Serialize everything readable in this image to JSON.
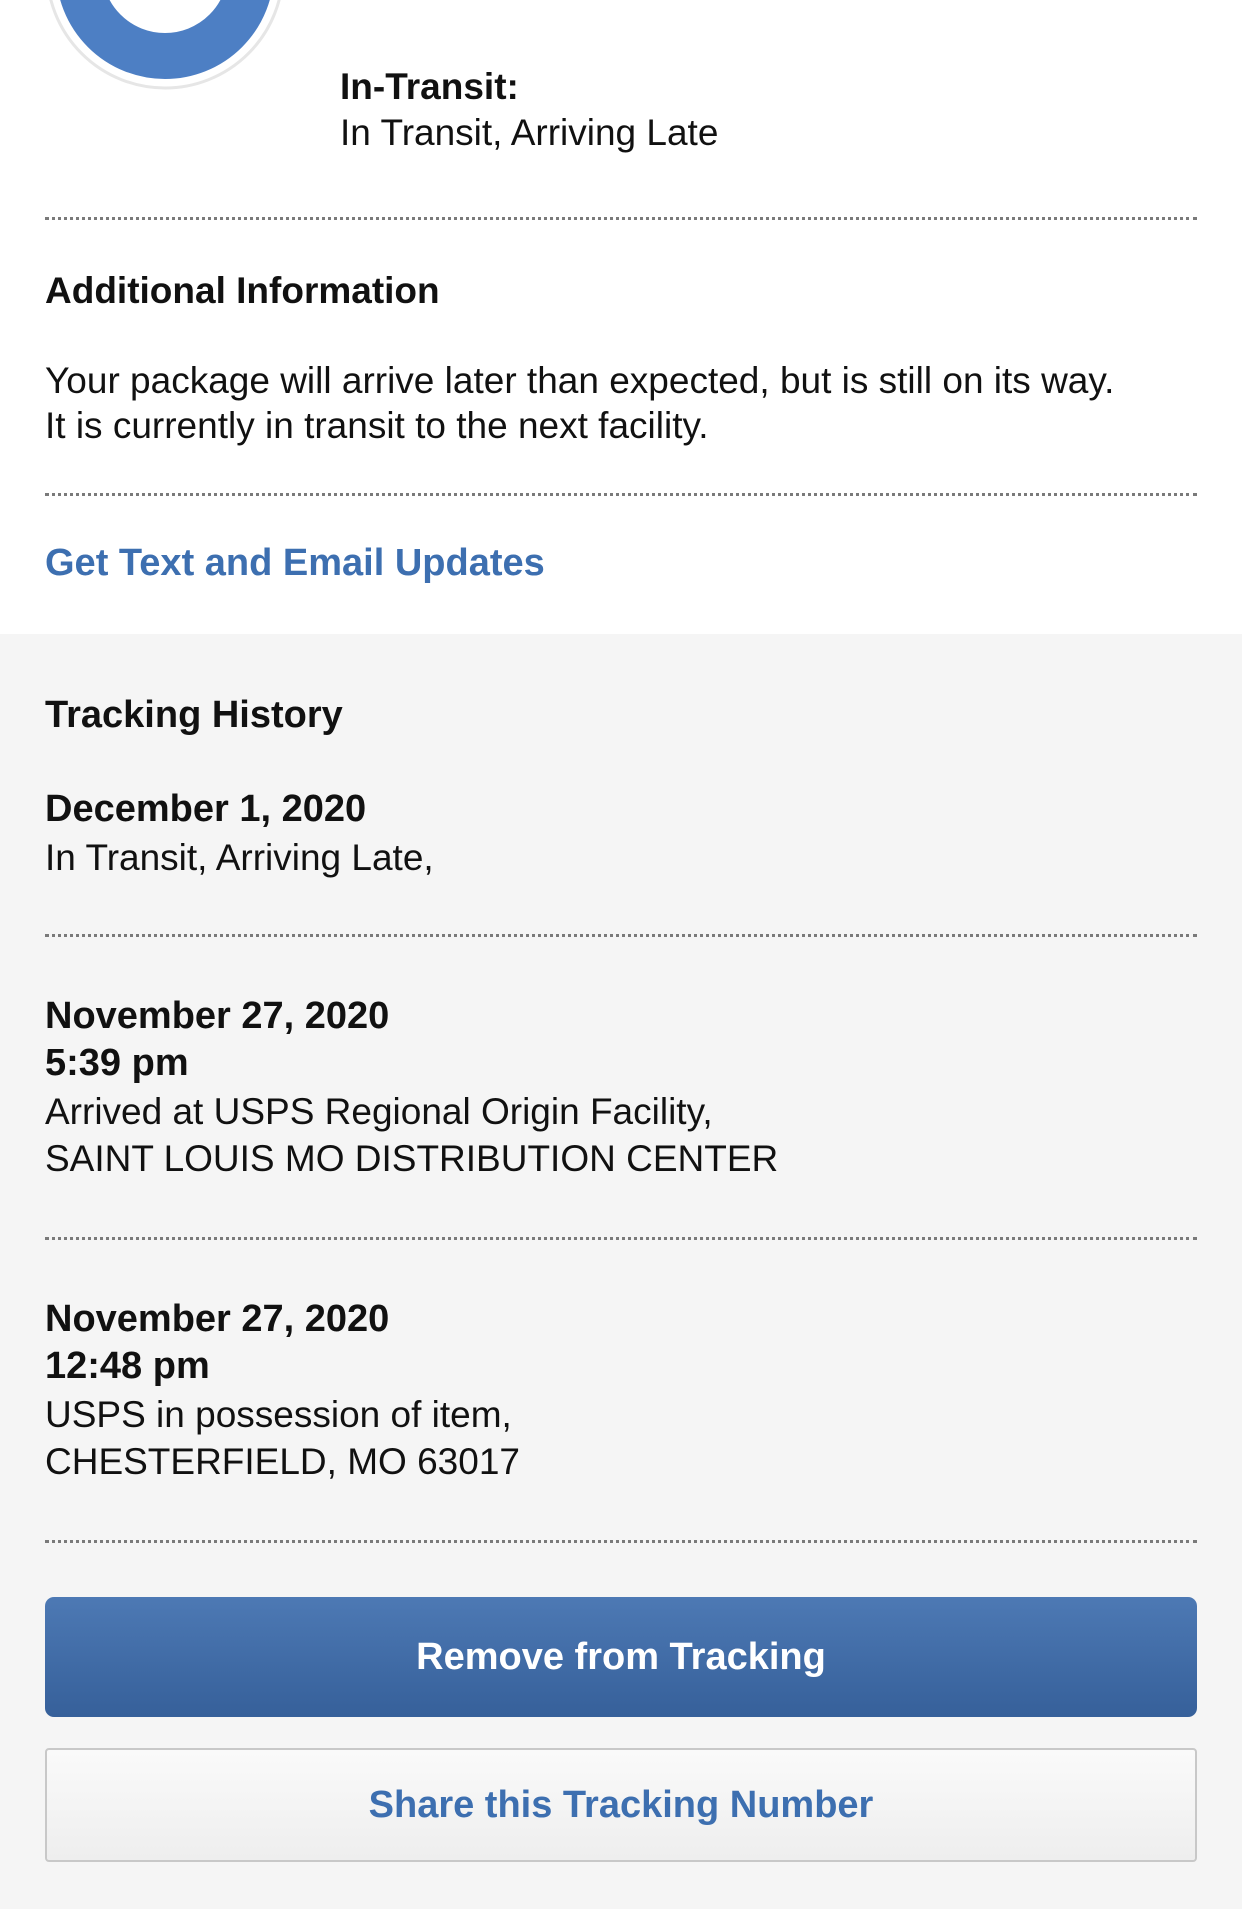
{
  "status": {
    "progress_icon": "progress-ring-icon",
    "label": "In-Transit:",
    "text": "In Transit, Arriving Late"
  },
  "additional": {
    "heading": "Additional Information",
    "line1": "Your package will arrive later than expected, but is still on its way.",
    "line2": "It is currently in transit to the next facility."
  },
  "updates_link": "Get Text and Email Updates",
  "history": {
    "heading": "Tracking History",
    "events": [
      {
        "date": "December 1, 2020",
        "time": "",
        "line1": "In Transit, Arriving Late,",
        "line2": ""
      },
      {
        "date": "November 27, 2020",
        "time": "5:39 pm",
        "line1": "Arrived at USPS Regional Origin Facility,",
        "line2": "SAINT LOUIS MO DISTRIBUTION CENTER"
      },
      {
        "date": "November 27, 2020",
        "time": "12:48 pm",
        "line1": "USPS in possession of item,",
        "line2": "CHESTERFIELD, MO 63017"
      }
    ]
  },
  "buttons": {
    "remove": "Remove from Tracking",
    "share": "Share this Tracking Number"
  },
  "colors": {
    "accent": "#3d6fb0",
    "button": "#4270aa",
    "ring": "#4d7fc4"
  }
}
